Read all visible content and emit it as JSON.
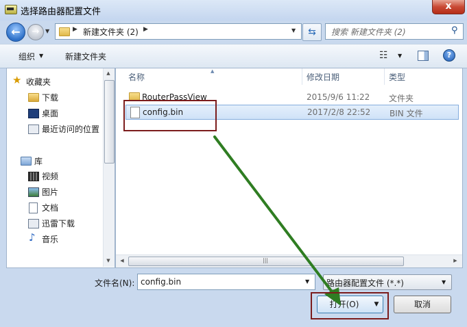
{
  "window": {
    "title": "选择路由器配置文件",
    "close_glyph": "x"
  },
  "nav": {
    "back_glyph": "←",
    "forward_glyph": "→"
  },
  "address": {
    "path": "新建文件夹 (2)"
  },
  "search": {
    "placeholder": "搜索 新建文件夹 (2)"
  },
  "toolbar": {
    "organize": "组织",
    "new_folder": "新建文件夹",
    "help": "?"
  },
  "sidebar": {
    "favorites": "收藏夹",
    "items_fav": [
      "下载",
      "桌面",
      "最近访问的位置"
    ],
    "libraries": "库",
    "items_lib": [
      "视频",
      "图片",
      "文档",
      "迅雷下载",
      "音乐"
    ]
  },
  "columns": {
    "name": "名称",
    "date": "修改日期",
    "type": "类型"
  },
  "files": [
    {
      "name": "RouterPassView",
      "date": "2015/9/6 11:22",
      "type": "文件夹",
      "icon": "folder-icon"
    },
    {
      "name": "config.bin",
      "date": "2017/2/8 22:52",
      "type": "BIN 文件",
      "icon": "file-icon"
    }
  ],
  "filename": {
    "label": "文件名(N):",
    "value": "config.bin"
  },
  "filetype": {
    "value": "路由器配置文件 (*.*)"
  },
  "buttons": {
    "open": "打开(O)",
    "cancel": "取消"
  },
  "annotation_colors": {
    "highlight_box": "#7b1c1c",
    "arrow": "#2f7d22"
  }
}
